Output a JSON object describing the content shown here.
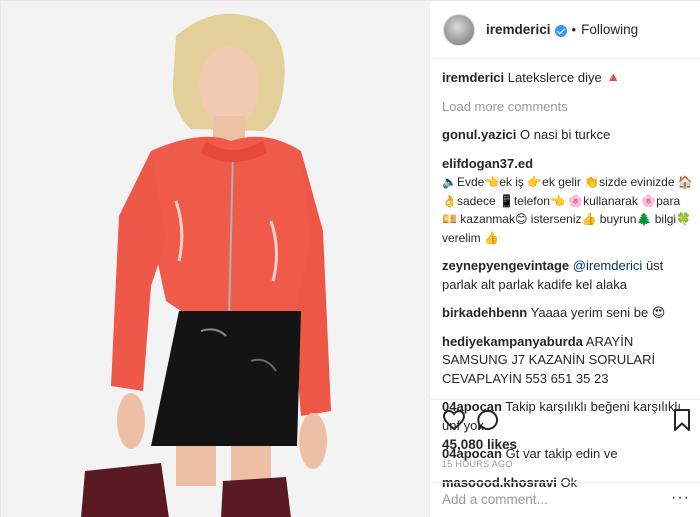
{
  "post": {
    "username": "iremderici",
    "verified": true,
    "follow_state": "Following",
    "separator": "•",
    "caption": {
      "user": "iremderici",
      "text": "Lateksler​ce diye 🔺"
    },
    "load_more": "Load more comments",
    "comments": [
      {
        "user": "gonul.yazici",
        "text": "O nasi bi turkce"
      },
      {
        "user": "elifdogan37.ed",
        "text": "🔈Evde👈ek iş 👉ek gelir 👏sizde evinizde 🏠👌sadece 📱telefon👈 🌸kullanarak 🌸para💴 kazanmak😊 isterseniz👍 buyrun🌲 bilgi🍀 verelim 👍"
      },
      {
        "user": "zeynepyengevintage",
        "mention": "@iremderici",
        "text": " üst parlak alt parlak kadife kel alaka"
      },
      {
        "user": "birkadehbenn",
        "text": "Yaaaa yerim seni be 😍"
      },
      {
        "user": "hediyekampanyaburda",
        "text": "ARAYİN SAMSUNG J7 KAZANİN SORULARİ CEVAPLAYİN 553 651 35 23"
      },
      {
        "user": "04apocan",
        "text": "Takip karşılıklı beğeni karşılıklı unf yok"
      },
      {
        "user": "04apocan",
        "text": "Gt var takip edin ve"
      },
      {
        "user": "masoood.khosravi",
        "text": "Ok"
      }
    ],
    "likes": "45,080 likes",
    "timestamp": "15 HOURS AGO",
    "add_comment_placeholder": "Add a comment...",
    "more_label": "···"
  },
  "icons": {
    "like": "heart-icon",
    "comment": "comment-icon",
    "save": "bookmark-icon",
    "verified": "verified-badge-icon"
  },
  "colors": {
    "verified_blue": "#3897f0",
    "mention": "#003569",
    "muted": "#999999",
    "jacket": "#f05a4a"
  }
}
